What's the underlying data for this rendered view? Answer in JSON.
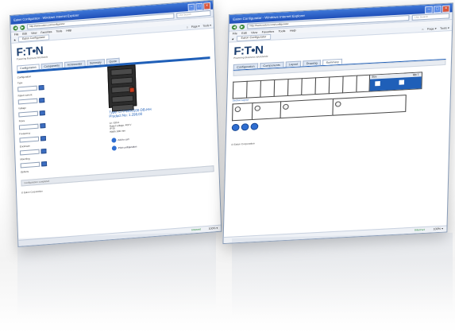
{
  "brand": {
    "logo": "F:T•N",
    "tagline": "Powering Business Worldwide"
  },
  "browser": {
    "title": "Eaton Configurator - Windows Internet Explorer",
    "address": "http://www.eaton.com/configurator",
    "search_placeholder": "Live Search",
    "menu": [
      "File",
      "Edit",
      "View",
      "Favorites",
      "Tools",
      "Help"
    ],
    "tab_label": "Eaton Configurator",
    "tools": [
      "Page ▾",
      "Tools ▾"
    ],
    "status_zone": "Internet",
    "zoom": "100% ▾"
  },
  "window1": {
    "tabs": [
      "Configuration",
      "Components",
      "Accessories",
      "Summary",
      "Quote"
    ],
    "breadcrumb": "Configuration",
    "fields": [
      {
        "label": "Type",
        "value": ""
      },
      {
        "label": "Rated current",
        "value": ""
      },
      {
        "label": "Voltage",
        "value": ""
      },
      {
        "label": "Poles",
        "value": ""
      },
      {
        "label": "Frequency",
        "value": ""
      },
      {
        "label": "Enclosure",
        "value": ""
      },
      {
        "label": "Mounting",
        "value": ""
      },
      {
        "label": "Options",
        "value": ""
      }
    ],
    "product_type": "Type: LT-FWD0100-DB-HH",
    "product_price": "Product No: 1.299,00",
    "specs": [
      "Ln: 630 A",
      "Rated voltage: 400 V",
      "IP 55",
      "Width: 800 mm"
    ],
    "action_buttons": [
      "Add to cart",
      "Print configuration"
    ],
    "footer_bar": "Configuration completed",
    "footer": "© Eaton Corporation"
  },
  "window2": {
    "tabs": [
      "Configuration",
      "Components",
      "Layout",
      "Drawing",
      "Summary"
    ],
    "selection_headers": [
      "Size",
      "Qty 1"
    ],
    "layout_label": "Section layout",
    "footer": "© Eaton Corporation"
  }
}
